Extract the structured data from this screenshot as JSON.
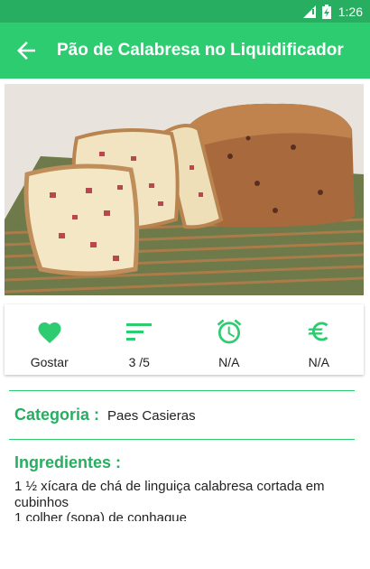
{
  "status_bar": {
    "time": "1:26"
  },
  "app_bar": {
    "title": "Pão de Calabresa no Liquidificador"
  },
  "hero": {
    "image_alt": "Pão de calabresa fatiado"
  },
  "actions": [
    {
      "icon": "heart-icon",
      "label": "Gostar"
    },
    {
      "icon": "sort-icon",
      "label": "3 /5"
    },
    {
      "icon": "alarm-clock-icon",
      "label": "N/A"
    },
    {
      "icon": "euro-icon",
      "label": "N/A"
    }
  ],
  "category": {
    "title": "Categoria :",
    "value": "Paes Casieras"
  },
  "ingredients": {
    "title": "Ingredientes :",
    "items": [
      "1 ½ xícara de chá de linguiça calabresa cortada em cubinhos",
      "1 colher (sopa) de conhaque"
    ]
  },
  "colors": {
    "primary": "#2ecc71",
    "primary_dark": "#27ae60"
  }
}
